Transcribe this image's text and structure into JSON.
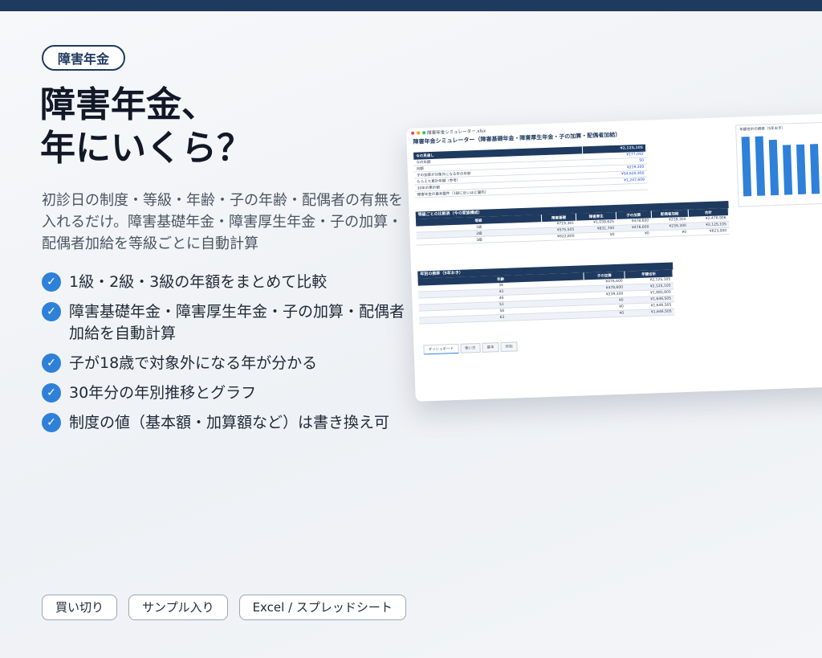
{
  "badge": "障害年金",
  "title_lines": [
    "障害年金、",
    "年にいくら？"
  ],
  "description": "初診日の制度・等級・年齢・子の年齢・配偶者の有無を入れるだけ。障害基礎年金・障害厚生年金・子の加算・配偶者加給を等級ごとに自動計算",
  "features": [
    "1級・2級・3級の年額をまとめて比較",
    "障害基礎年金・障害厚生年金・子の加算・配偶者加給を自動計算",
    "子が18歳で対象外になる年が分かる",
    "30年分の年別推移とグラフ",
    "制度の値（基本額・加算額など）は書き換え可"
  ],
  "check_icon": "check-circle-icon",
  "tags": [
    "買い切り",
    "サンプル入り",
    "Excel / スプレッドシート"
  ],
  "colors": {
    "accent": "#2f80d8",
    "navy": "#1e3a5f"
  },
  "spreadsheet": {
    "filename": "障害年金シミュレーター.xlsx",
    "heading": "障害年金シミュレーター（障害基礎年金・障害厚生年金・子の加算・配偶者加給）",
    "summary": {
      "header_label": "今の見通し",
      "header_value": "¥2,125,105",
      "rows": [
        {
          "label": "今の年額",
          "value": "¥177,092"
        },
        {
          "label": "月額",
          "value": "50"
        },
        {
          "label": "子の加算が対象外になる年の年齢",
          "value": "¥219,300"
        },
        {
          "label": "もらえた累計年額（参考）",
          "value": "¥54,620,450"
        },
        {
          "label": "30年の累計額",
          "value": "¥1,247,609"
        },
        {
          "label": "障害年金の基本要件（1級に近いほど優先）",
          "value": ""
        }
      ]
    },
    "compare": {
      "title": "等級ごとの比較表（今の家族構成）",
      "headers": [
        "等級",
        "障害基礎",
        "障害厚生",
        "子の加算",
        "配偶者加給",
        "合計"
      ],
      "rows": [
        [
          "1級",
          "¥719,381",
          "¥1,039,625",
          "¥478,600",
          "¥239,300",
          "¥2,476,906"
        ],
        [
          "2級",
          "¥575,505",
          "¥831,700",
          "¥478,600",
          "¥239,300",
          "¥2,125,105"
        ],
        [
          "3級",
          "¥622,800",
          "¥0",
          "¥0",
          "¥0",
          "¥623,000"
        ]
      ]
    },
    "yearly": {
      "title": "年別の推移（5年おき）",
      "headers": [
        "年齢",
        "子の加算",
        "年額合計"
      ],
      "rows": [
        [
          "38",
          "¥478,600",
          "¥2,125,105"
        ],
        [
          "43",
          "¥478,600",
          "¥2,125,105"
        ],
        [
          "46",
          "¥239,300",
          "¥1,885,805"
        ],
        [
          "51",
          "¥0",
          "¥1,646,505"
        ],
        [
          "58",
          "¥0",
          "¥1,646,505"
        ],
        [
          "63",
          "¥0",
          "¥1,646,505"
        ]
      ]
    },
    "sheet_tabs": [
      "ダッシュボード",
      "使い方",
      "基本",
      "年別"
    ],
    "chart": {
      "title": "年額合計の推移（5年おき）",
      "values": [
        100,
        100,
        93,
        84,
        84,
        84
      ]
    }
  }
}
